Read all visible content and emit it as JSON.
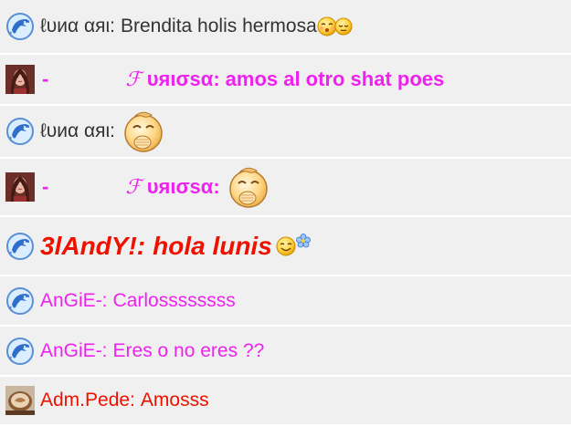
{
  "messages": [
    {
      "avatar": "dolphin-icon",
      "name": "ℓυиα αяι:",
      "text": "Brendita holis hermosa",
      "emoji": [
        "kiss-smiley-icon",
        "blush-smiley-icon"
      ]
    },
    {
      "avatar": "girl-photo-avatar",
      "prefix": "-",
      "script_letter": "ℱ",
      "name": "υяισѕα:",
      "text": "amos al otro shat poes"
    },
    {
      "avatar": "dolphin-icon",
      "name": "ℓυиα αяι:",
      "text": "",
      "emoji": [
        "giggle-smiley-icon"
      ]
    },
    {
      "avatar": "girl-photo-avatar",
      "prefix": "-",
      "script_letter": "ℱ",
      "name": "υяισѕα:",
      "text": "",
      "emoji": [
        "giggle-smiley-icon"
      ]
    },
    {
      "avatar": "dolphin-icon",
      "name": "3lAndY!:",
      "text": "hola lunis",
      "emoji": [
        "smile-smiley-icon",
        "flower-icon"
      ]
    },
    {
      "avatar": "dolphin-icon",
      "name": "AnGiE-:",
      "text": "Carlossssssss"
    },
    {
      "avatar": "dolphin-icon",
      "name": "AnGiE-:",
      "text": "Eres o no eres ??"
    },
    {
      "avatar": "coffee-photo-avatar",
      "name": "Adm.Pede:",
      "text": "Amosss"
    }
  ],
  "colors": {
    "magenta": "#ee22ee",
    "red": "#ee1100",
    "dark_text": "#333333",
    "row_bg": "#f0f0f0"
  }
}
